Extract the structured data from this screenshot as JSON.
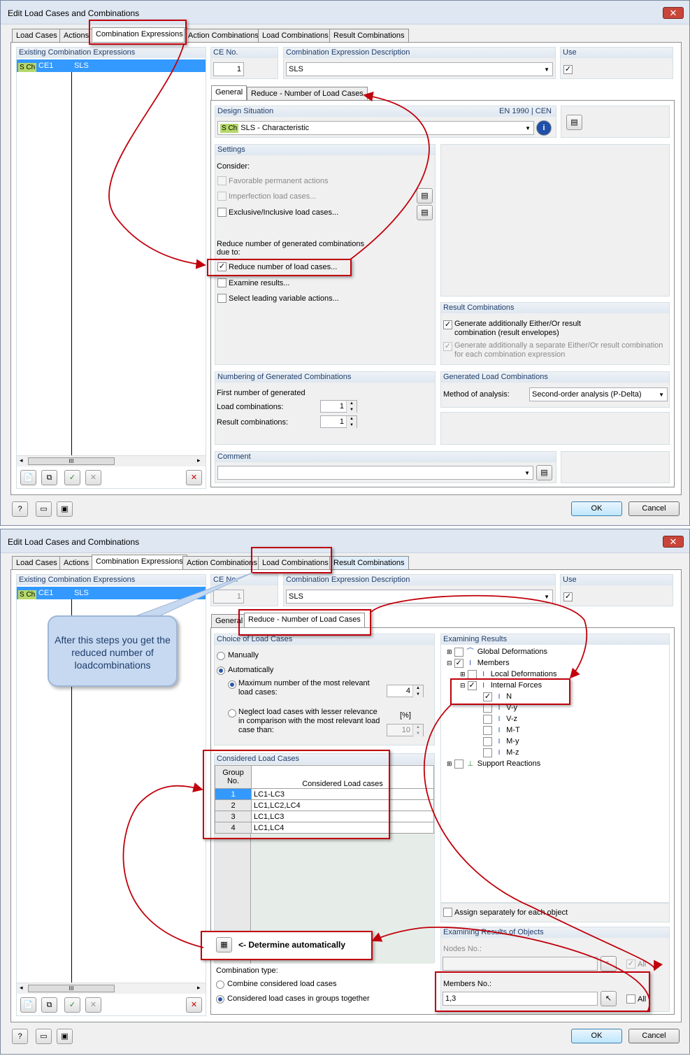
{
  "window_title": "Edit Load Cases and Combinations",
  "tabs": [
    "Load Cases",
    "Actions",
    "Combination Expressions",
    "Action Combinations",
    "Load Combinations",
    "Result Combinations"
  ],
  "existing": {
    "header": "Existing Combination Expressions",
    "item_badge": "S Ch",
    "item_id": "CE1",
    "item_desc": "SLS",
    "scroll_grip": "III"
  },
  "ce": {
    "no_label": "CE No.",
    "no_value": "1",
    "desc_label": "Combination Expression Description",
    "desc_value": "SLS",
    "use_label": "Use",
    "use_check": "✓"
  },
  "subtabs": [
    "General",
    "Reduce - Number of Load Cases"
  ],
  "design": {
    "header": "Design Situation",
    "standard": "EN 1990 | CEN",
    "badge": "S Ch",
    "value": "SLS - Characteristic"
  },
  "settings": {
    "header": "Settings",
    "consider": "Consider:",
    "fav": "Favorable permanent actions",
    "imperf": "Imperfection load cases...",
    "excl": "Exclusive/Inclusive load cases...",
    "reduce_intro": "Reduce number of generated combinations due to:",
    "reduce_lc": "Reduce number of load cases...",
    "examine": "Examine results...",
    "leading": "Select leading variable actions..."
  },
  "result_comb": {
    "header": "Result Combinations",
    "opt1": "Generate additionally Either/Or result combination (result envelopes)",
    "opt2": "Generate additionally a separate Either/Or result combination for each combination expression"
  },
  "numbering": {
    "header": "Numbering of Generated Combinations",
    "first": "First number of generated",
    "lc_label": "Load combinations:",
    "lc_value": "1",
    "rc_label": "Result combinations:",
    "rc_value": "1"
  },
  "generated": {
    "header": "Generated Load Combinations",
    "method_label": "Method of analysis:",
    "method_value": "Second-order analysis (P-Delta)"
  },
  "comment": {
    "header": "Comment",
    "value": ""
  },
  "buttons": {
    "ok": "OK",
    "cancel": "Cancel"
  },
  "reduce": {
    "choice_header": "Choice of Load Cases",
    "manual": "Manually",
    "auto": "Automatically",
    "max_label": "Maximum number of the most relevant load cases:",
    "max_value": "4",
    "neglect_label": "Neglect load cases with lesser relevance in comparison with the most relevant load case than:",
    "pct_label": "[%]",
    "neglect_value": "10",
    "considered_header": "Considered Load Cases",
    "group_col": "Group No.",
    "lc_col": "Considered Load cases",
    "rows": [
      {
        "group": "1",
        "lcs": "LC1-LC3"
      },
      {
        "group": "2",
        "lcs": "LC1,LC2,LC4"
      },
      {
        "group": "3",
        "lcs": "LC1,LC3"
      },
      {
        "group": "4",
        "lcs": "LC1,LC4"
      }
    ],
    "determine": "<- Determine automatically",
    "combo_type": "Combination type:",
    "combine": "Combine considered load cases",
    "groups": "Considered load cases in groups together",
    "exam_header": "Examining Results",
    "tree": {
      "global": "Global Deformations",
      "members": "Members",
      "local": "Local Deformations",
      "internal": "Internal Forces",
      "n": "N",
      "vy": "V-y",
      "vz": "V-z",
      "mt": "M-T",
      "my": "M-y",
      "mz": "M-z",
      "support": "Support Reactions"
    },
    "assign": "Assign separately for each object",
    "objects_header": "Examining Results of Objects",
    "nodes_label": "Nodes No.:",
    "nodes_value": "",
    "members_label": "Members No.:",
    "members_value": "1,3",
    "all": "All"
  },
  "callout": "After this steps you get the reduced number of loadcombinations",
  "icons": {
    "info": "i",
    "help": "?",
    "close": "✕",
    "delete": "✕",
    "check": "✓"
  },
  "colors": {
    "annotation": "#c0000b",
    "selection": "#3399ff",
    "callout": "#c6d9f1"
  }
}
